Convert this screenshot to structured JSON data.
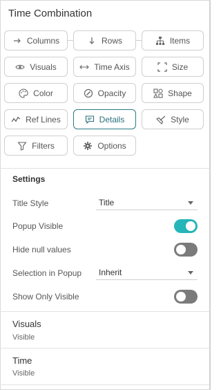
{
  "panel": {
    "title": "Time Combination"
  },
  "buttons": {
    "columns": "Columns",
    "rows": "Rows",
    "items": "Items",
    "visuals": "Visuals",
    "time_axis": "Time Axis",
    "size": "Size",
    "color": "Color",
    "opacity": "Opacity",
    "shape": "Shape",
    "ref_lines": "Ref Lines",
    "details": "Details",
    "style": "Style",
    "filters": "Filters",
    "options": "Options"
  },
  "active_button": "details",
  "colors": {
    "accent": "#26b5b8",
    "active_border": "#2a7a86",
    "toggle_off": "#7b7b7b"
  },
  "settings": {
    "heading": "Settings",
    "title_style": {
      "label": "Title Style",
      "value": "Title"
    },
    "popup_visible": {
      "label": "Popup Visible",
      "on": true
    },
    "hide_null": {
      "label": "Hide null values",
      "on": false
    },
    "selection_popup": {
      "label": "Selection in Popup",
      "value": "Inherit"
    },
    "show_only_visible": {
      "label": "Show Only Visible",
      "on": false
    }
  },
  "sections": [
    {
      "title": "Visuals",
      "value": "Visible"
    },
    {
      "title": "Time",
      "value": "Visible"
    }
  ]
}
